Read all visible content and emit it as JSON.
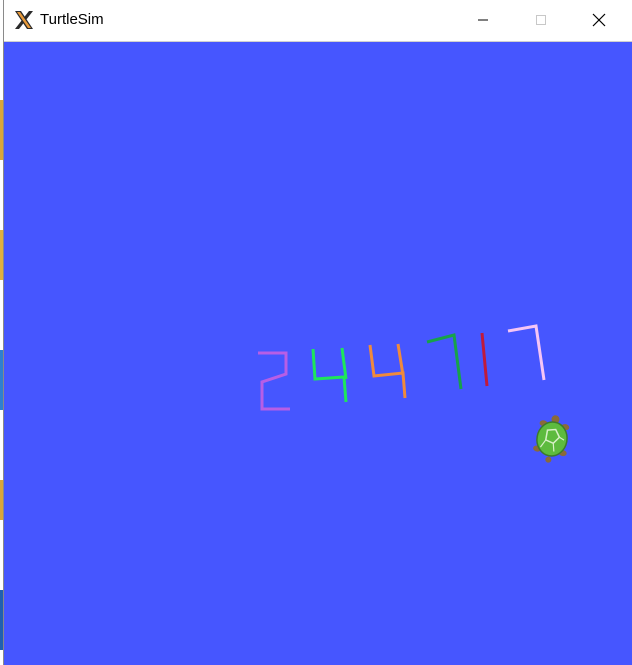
{
  "window": {
    "title": "TurtleSim",
    "app_icon": "x-logo-icon",
    "controls": [
      "minimize-icon",
      "maximize-icon",
      "close-icon"
    ]
  },
  "canvas": {
    "background": "#4656FF",
    "drawn_digits": [
      {
        "digit": "2",
        "color": "#B75EE6"
      },
      {
        "digit": "4",
        "color": "#1EE65A"
      },
      {
        "digit": "4",
        "color": "#F08A3C"
      },
      {
        "digit": "7",
        "color": "#17A24A"
      },
      {
        "digit": "1",
        "color": "#C01A3C"
      },
      {
        "digit": "7",
        "color": "#F5C5F5"
      }
    ],
    "turtle": {
      "icon": "turtle-icon",
      "shell_color": "#5DBB3E"
    }
  }
}
